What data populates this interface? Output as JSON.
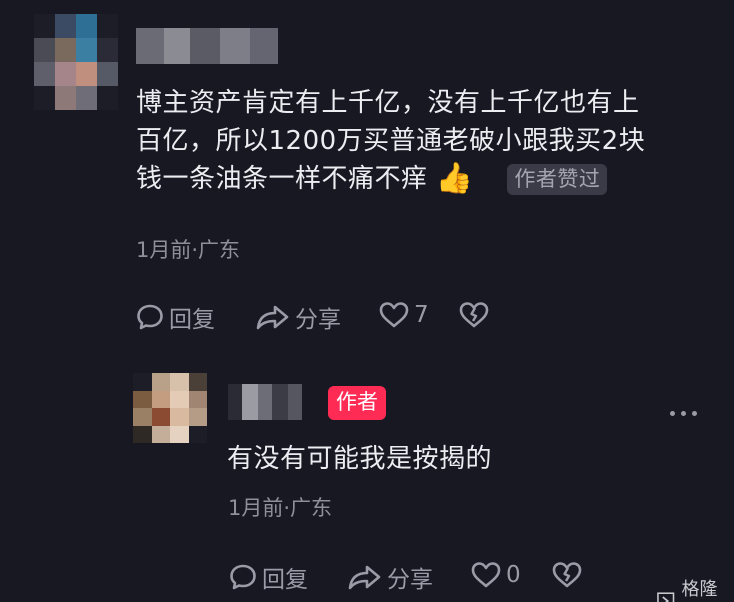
{
  "comment": {
    "text_lines": [
      "博主资产肯定有上千亿，没有上千亿也有上",
      "百亿，所以1200万买普通老破小跟我买2块",
      "钱一条油条一样不痛不痒"
    ],
    "emoji": "👍",
    "badge": "作者赞过",
    "meta": "1月前·广东",
    "actions": {
      "reply": "回复",
      "share": "分享",
      "like_count": "7"
    }
  },
  "reply": {
    "author_badge": "作者",
    "text": "有没有可能我是按揭的",
    "meta": "1月前·广东",
    "actions": {
      "reply": "回复",
      "share": "分享",
      "like_count": "0"
    }
  },
  "watermark": {
    "text": "格隆汇"
  },
  "colors": {
    "background": "#171822",
    "author_badge": "#fe2c55",
    "muted_text": "#8e8f99"
  }
}
